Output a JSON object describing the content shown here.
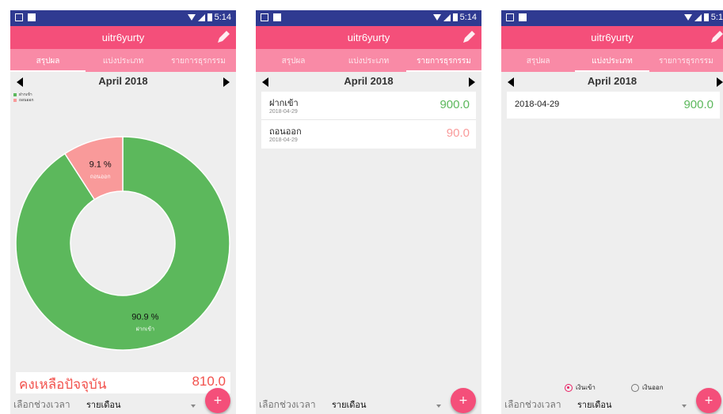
{
  "colors": {
    "status_bar": "#2f3a91",
    "toolbar": "#f44f7a",
    "tabs": "#f98aa6",
    "income": "#5cb85c",
    "expense": "#f99a9a",
    "balance": "#f2524d"
  },
  "status": {
    "time": "5:14",
    "time_clipped": "5:1"
  },
  "app": {
    "title": "uitr6yurty",
    "edit_icon": "pencil-icon"
  },
  "tabs": [
    "สรุปผล",
    "แบ่งประเภท",
    "รายการธุรกรรม"
  ],
  "month": "April 2018",
  "legend": [
    "ฝากเข้า",
    "ถอนออก"
  ],
  "chart_data": {
    "type": "pie",
    "donut": true,
    "categories": [
      "ฝากเข้า",
      "ถอนออก"
    ],
    "values": [
      90.9,
      9.1
    ],
    "labels": [
      "90.9 %",
      "9.1 %"
    ],
    "colors": [
      "#5cb85c",
      "#f99a9a"
    ],
    "legend_position": "top-left"
  },
  "balance": {
    "label": "คงเหลือปัจจุบัน",
    "value": "810.0"
  },
  "period": {
    "label": "เลือกช่วงเวลา",
    "value": "รายเดือน"
  },
  "fab": "+",
  "transactions": [
    {
      "name": "ฝากเข้า",
      "date": "2018-04-29",
      "amount": "900.0"
    },
    {
      "name": "ถอนออก",
      "date": "2018-04-29",
      "amount": "90.0"
    }
  ],
  "daily": [
    {
      "date": "2018-04-29",
      "amount": "900.0"
    }
  ],
  "radio_options": [
    "เงินเข้า",
    "เงินออก"
  ]
}
